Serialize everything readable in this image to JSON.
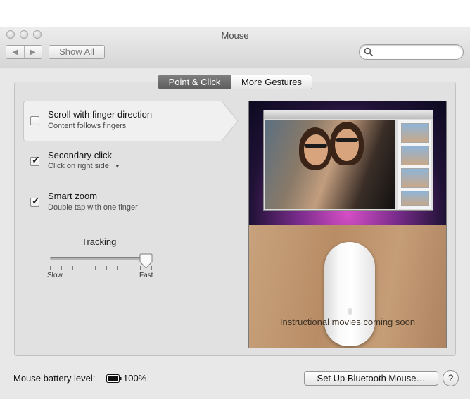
{
  "window": {
    "title": "Mouse"
  },
  "toolbar": {
    "back_icon": "◀",
    "forward_icon": "▶",
    "show_all_label": "Show All",
    "search_value": ""
  },
  "tabs": [
    {
      "label": "Point & Click",
      "selected": true
    },
    {
      "label": "More Gestures",
      "selected": false
    }
  ],
  "options": [
    {
      "title": "Scroll with finger direction",
      "subtitle": "Content follows fingers",
      "checked": false,
      "highlighted": true
    },
    {
      "title": "Secondary click",
      "subtitle": "Click on right side",
      "checked": true,
      "has_dropdown": true
    },
    {
      "title": "Smart zoom",
      "subtitle": "Double tap with one finger",
      "checked": true
    }
  ],
  "checkmark": "✓",
  "dropdown_arrow": "▼",
  "tracking": {
    "title": "Tracking",
    "min_label": "Slow",
    "max_label": "Fast",
    "value_fraction": 0.95,
    "tick_count": 10
  },
  "movie": {
    "caption": "Instructional movies coming soon"
  },
  "footer": {
    "battery_label": "Mouse battery level:",
    "battery_value": "100%",
    "bluetooth_button": "Set Up Bluetooth Mouse…",
    "help_label": "?"
  }
}
